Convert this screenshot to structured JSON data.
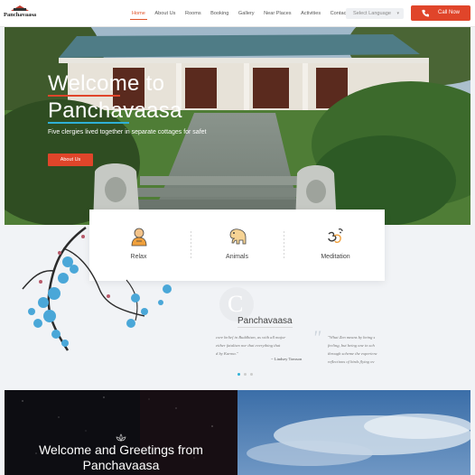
{
  "header": {
    "brand": "Panchavaasa",
    "nav": [
      "Home",
      "About Us",
      "Rooms",
      "Booking",
      "Gallery",
      "Near Places",
      "Activities",
      "Contact"
    ],
    "active_nav": "Home",
    "language_select": {
      "value": "Select Language",
      "caret": "▾"
    },
    "call_button": "Call Now"
  },
  "hero": {
    "title_line1": "Welcome to",
    "title_line2": "Panchavaasa",
    "subtitle": "Five clergies lived together in separate cottages for safet",
    "button": "About Us"
  },
  "features": [
    {
      "label": "Relax",
      "icon": "monk-icon"
    },
    {
      "label": "Animals",
      "icon": "elephant-icon"
    },
    {
      "label": "Meditation",
      "icon": "om-icon"
    }
  ],
  "testimonial": {
    "logo_letter": "C",
    "name": "Panchavaasa",
    "left_quote_lines": [
      "core belief in Buddhism, as with all major",
      "either fatalism nor that everything that",
      "d by Karma.\""
    ],
    "left_author": "~ Lindsey Tomson",
    "quote_mark": "\"",
    "right_quote_lines": [
      "\"What Zen means by being s",
      "feeling, but being one in sch",
      "through scheme the experienc",
      "reflections of birds flying ov"
    ],
    "carousel_active_index": 0
  },
  "bottom": {
    "title_line1": "Welcome and Greetings from",
    "title_line2": "Panchavaasa"
  },
  "colors": {
    "accent_orange": "#e0452a",
    "accent_blue": "#2fb0d6",
    "nav_active": "#e0542a"
  }
}
